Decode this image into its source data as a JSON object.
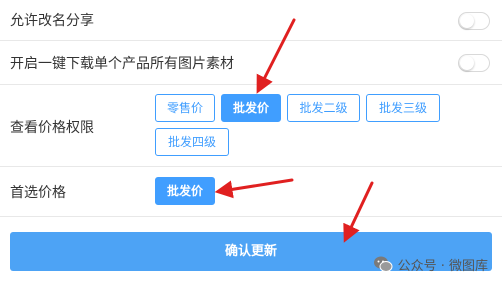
{
  "settings": {
    "allow_rename_share": {
      "label": "允许改名分享",
      "enabled": false
    },
    "one_click_download": {
      "label": "开启一键下载单个产品所有图片素材",
      "enabled": false
    },
    "view_price_permission": {
      "label": "查看价格权限",
      "options": [
        "零售价",
        "批发价",
        "批发二级",
        "批发三级",
        "批发四级"
      ],
      "selected": "批发价"
    },
    "preferred_price": {
      "label": "首选价格",
      "selected_label": "批发价"
    }
  },
  "actions": {
    "confirm_update": "确认更新"
  },
  "watermark": {
    "text": "公众号 · 微图库"
  },
  "colors": {
    "accent": "#409eff",
    "submit_bg": "#4da3f5",
    "annotation_arrow": "#e02020"
  }
}
